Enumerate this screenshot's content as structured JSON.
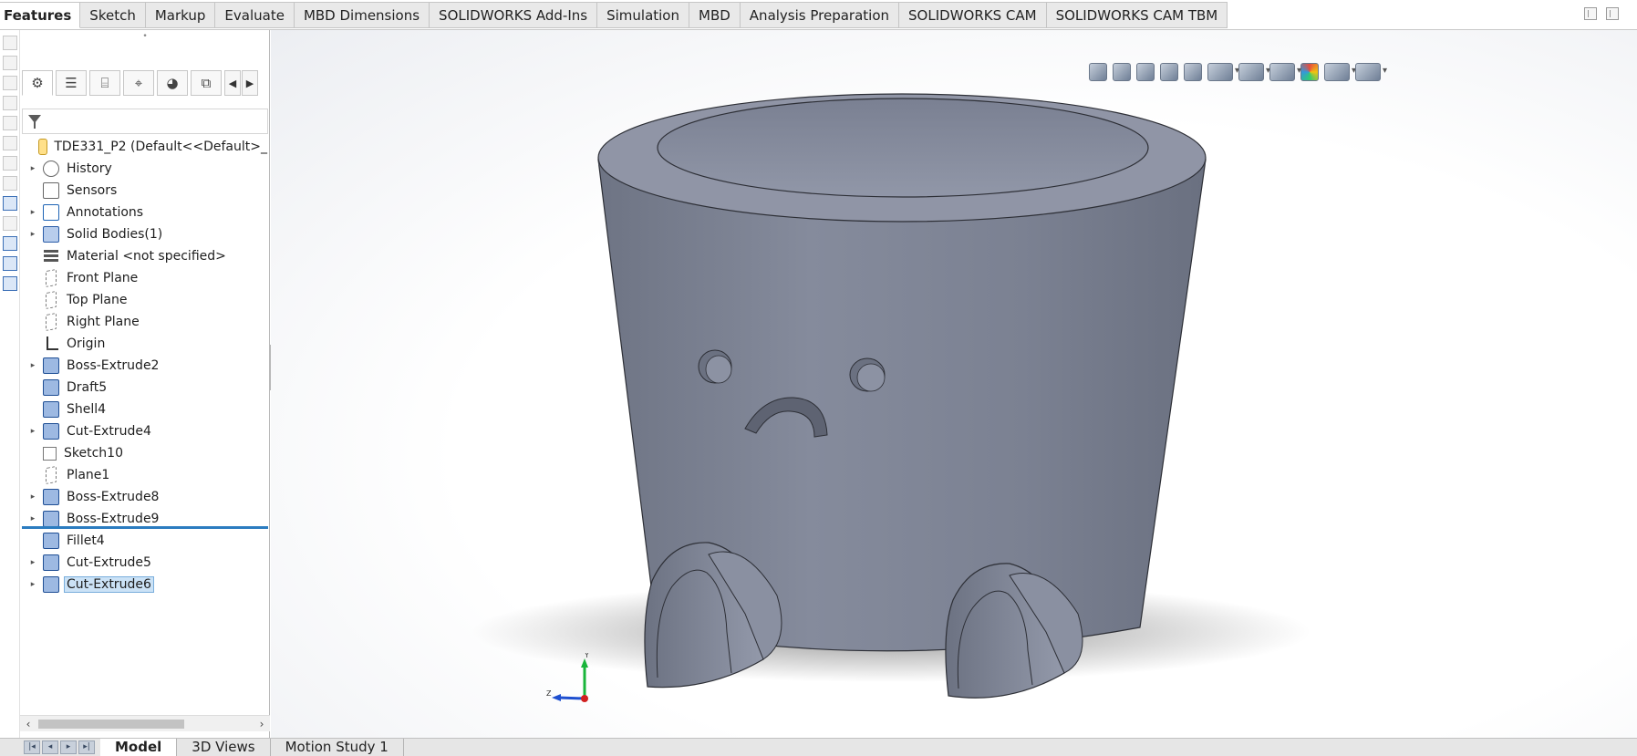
{
  "command_tabs": [
    {
      "label": "Features",
      "active": true
    },
    {
      "label": "Sketch"
    },
    {
      "label": "Markup"
    },
    {
      "label": "Evaluate"
    },
    {
      "label": "MBD Dimensions"
    },
    {
      "label": "SOLIDWORKS Add-Ins"
    },
    {
      "label": "Simulation"
    },
    {
      "label": "MBD"
    },
    {
      "label": "Analysis Preparation"
    },
    {
      "label": "SOLIDWORKS CAM"
    },
    {
      "label": "SOLIDWORKS CAM TBM"
    }
  ],
  "feature_manager": {
    "root_label": "TDE331_P2  (Default<<Default>_",
    "items": [
      {
        "label": "History",
        "icon": "history-icon",
        "expandable": true
      },
      {
        "label": "Sensors",
        "icon": "sensor-icon",
        "expandable": false
      },
      {
        "label": "Annotations",
        "icon": "annotation-icon",
        "expandable": true
      },
      {
        "label": "Solid Bodies(1)",
        "icon": "solid-bodies-icon",
        "expandable": true
      },
      {
        "label": "Material <not specified>",
        "icon": "material-icon",
        "expandable": false
      },
      {
        "label": "Front Plane",
        "icon": "plane-icon",
        "expandable": false
      },
      {
        "label": "Top Plane",
        "icon": "plane-icon",
        "expandable": false
      },
      {
        "label": "Right Plane",
        "icon": "plane-icon",
        "expandable": false
      },
      {
        "label": "Origin",
        "icon": "origin-icon",
        "expandable": false
      },
      {
        "label": "Boss-Extrude2",
        "icon": "boss-extrude-icon",
        "expandable": true
      },
      {
        "label": "Draft5",
        "icon": "draft-icon",
        "expandable": false
      },
      {
        "label": "Shell4",
        "icon": "shell-icon",
        "expandable": false
      },
      {
        "label": "Cut-Extrude4",
        "icon": "cut-extrude-icon",
        "expandable": true
      },
      {
        "label": "Sketch10",
        "icon": "sketch-icon",
        "expandable": false
      },
      {
        "label": "Plane1",
        "icon": "plane-icon",
        "expandable": false
      },
      {
        "label": "Boss-Extrude8",
        "icon": "boss-extrude-icon",
        "expandable": true
      },
      {
        "label": "Boss-Extrude9",
        "icon": "boss-extrude-icon",
        "expandable": true
      },
      {
        "label": "Fillet4",
        "icon": "fillet-icon",
        "expandable": false
      },
      {
        "label": "Cut-Extrude5",
        "icon": "cut-extrude-icon",
        "expandable": true
      },
      {
        "label": "Cut-Extrude6",
        "icon": "cut-extrude-icon",
        "expandable": true,
        "selected": true
      }
    ]
  },
  "bottom_tabs": [
    {
      "label": "Model",
      "active": true
    },
    {
      "label": "3D Views"
    },
    {
      "label": "Motion Study 1"
    }
  ],
  "triad": {
    "y_label": "Y",
    "z_label": "Z"
  },
  "colors": {
    "selection": "#cbe2f6",
    "accent_blue": "#2b7cc0",
    "model_body": "#7f8596"
  }
}
